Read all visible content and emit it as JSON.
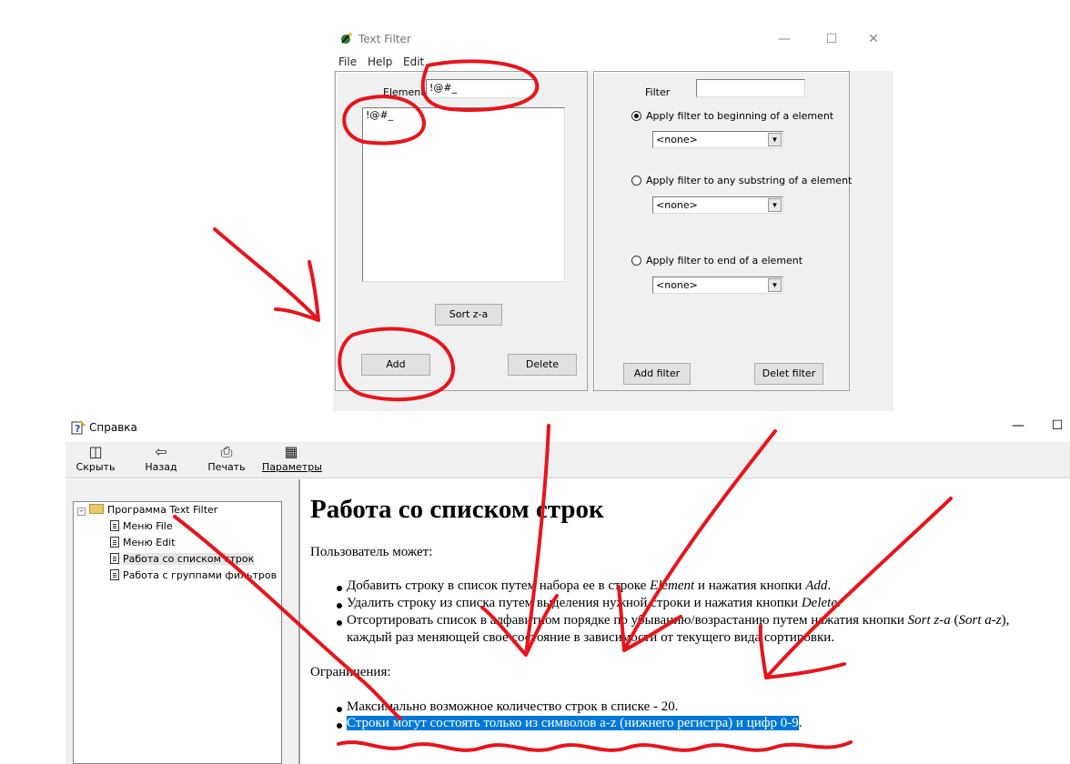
{
  "text_filter_window": {
    "title": "Text Filter",
    "menu": [
      "File",
      "Help",
      "Edit"
    ],
    "element_label": "Element",
    "element_value": "!@#_",
    "list_items": [
      "!@#_"
    ],
    "sort_button": "Sort z-a",
    "add_button": "Add",
    "delete_button": "Delete",
    "filter_label": "Filter",
    "filter_value": "",
    "options": [
      {
        "label": "Apply filter to beginning of a element",
        "selected": true,
        "combo_value": "<none>"
      },
      {
        "label": "Apply filter to any substring of a element",
        "selected": false,
        "combo_value": "<none>"
      },
      {
        "label": "Apply filter to end of a element",
        "selected": false,
        "combo_value": "<none>"
      }
    ],
    "add_filter_button": "Add filter",
    "delete_filter_button": "Delet filter"
  },
  "help_window": {
    "title": "Справка",
    "toolbar": [
      {
        "label": "Скрыть",
        "icon": "hide-icon"
      },
      {
        "label": "Назад",
        "icon": "back-arrow-icon"
      },
      {
        "label": "Печать",
        "icon": "printer-icon"
      },
      {
        "label": "Параметры",
        "icon": "options-icon"
      }
    ],
    "tree": {
      "root": "Программа Text Filter",
      "children": [
        "Меню File",
        "Меню Edit",
        "Работа со списком строк",
        "Работа с группами фильтров"
      ],
      "selected_index": 2
    },
    "content": {
      "heading": "Работа со списком строк",
      "intro": "Пользователь может:",
      "bullets1": [
        {
          "a": "Добавить строку в список путем набора ее в строке ",
          "b": "Element",
          "c": " и нажатия кнопки ",
          "d": "Add",
          "e": "."
        },
        {
          "a": "Удалить строку из списка путем выделения нужной строки и нажатия кнопки ",
          "b": "Delete",
          "c": "."
        },
        {
          "a": "Отсортировать список в алфавитном порядке по убыванию/возрастанию путем нажатия кнопки ",
          "b": "Sort z-a",
          "c": " (",
          "d": "Sort a-z",
          "e": "),",
          "f": "каждый раз меняющей свое состояние в зависимости от текущего вида сортировки."
        }
      ],
      "restrictions_title": "Ограничения:",
      "bullets2": [
        "Максимально возможное количество строк в списке - 20.",
        "Строки могут состоять только из символов a-z (нижнего регистра) и цифр 0-9"
      ],
      "bullets2_tail": "."
    }
  },
  "annotation_color": "#e8141c"
}
